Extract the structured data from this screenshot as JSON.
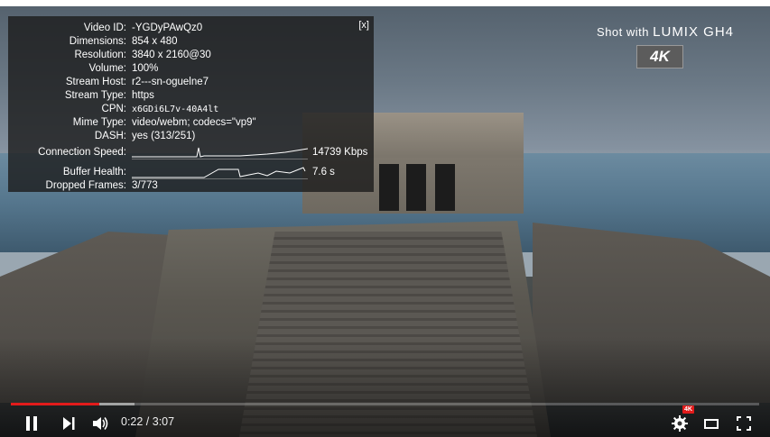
{
  "video": {
    "watermark_prefix": "Shot with",
    "watermark_brand": "LUMIX GH4",
    "badge": "4K"
  },
  "stats": {
    "close_label": "[x]",
    "rows": [
      {
        "label": "Video ID:",
        "value": "-YGDyPAwQz0"
      },
      {
        "label": "Dimensions:",
        "value": "854 x 480"
      },
      {
        "label": "Resolution:",
        "value": "3840 x 2160@30"
      },
      {
        "label": "Volume:",
        "value": "100%"
      },
      {
        "label": "Stream Host:",
        "value": "r2---sn-oguelne7"
      },
      {
        "label": "Stream Type:",
        "value": "https"
      },
      {
        "label": "CPN:",
        "value": "x6GDi6L7v-40A4lt"
      },
      {
        "label": "Mime Type:",
        "value": "video/webm; codecs=\"vp9\""
      },
      {
        "label": "DASH:",
        "value": "yes (313/251)"
      }
    ],
    "connection_speed": {
      "label": "Connection Speed:",
      "value": "14739 Kbps"
    },
    "buffer_health": {
      "label": "Buffer Health:",
      "value": "7.6 s"
    },
    "dropped_frames": {
      "label": "Dropped Frames:",
      "value": "3/773"
    }
  },
  "player": {
    "time": "0:22 / 3:07",
    "progress_played": 0.118,
    "progress_buffered": 0.165,
    "quality_badge": "4K",
    "accent_color": "#e21b1b"
  }
}
